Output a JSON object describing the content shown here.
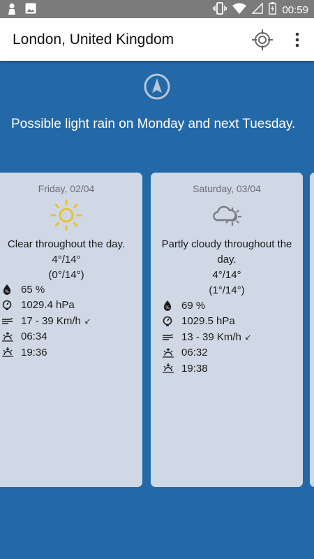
{
  "status_bar": {
    "time": "00:59"
  },
  "app_bar": {
    "title": "London, United Kingdom"
  },
  "forecast": {
    "summary": "Possible light rain on Monday and next Tuesday."
  },
  "days": [
    {
      "date": "Friday, 02/04",
      "icon": "sun-icon",
      "description": "Clear throughout the day.",
      "temp": "4°/14°",
      "feels_like": "(0°/14°)",
      "humidity": "65 %",
      "pressure": "1029.4 hPa",
      "wind": "17 - 39 Km/h",
      "wind_direction_glyph": "↙",
      "sunrise": "06:34",
      "sunset": "19:36"
    },
    {
      "date": "Saturday, 03/04",
      "icon": "partly-cloudy-icon",
      "description": "Partly cloudy throughout the day.",
      "temp": "4°/14°",
      "feels_like": "(1°/14°)",
      "humidity": "69 %",
      "pressure": "1029.5 hPa",
      "wind": "13 - 39 Km/h",
      "wind_direction_glyph": "↙",
      "sunrise": "06:32",
      "sunset": "19:38"
    }
  ],
  "colors": {
    "background": "#2369a7",
    "card": "#d1d8e5",
    "sun": "#e6c22f",
    "cloud": "#777b82"
  }
}
